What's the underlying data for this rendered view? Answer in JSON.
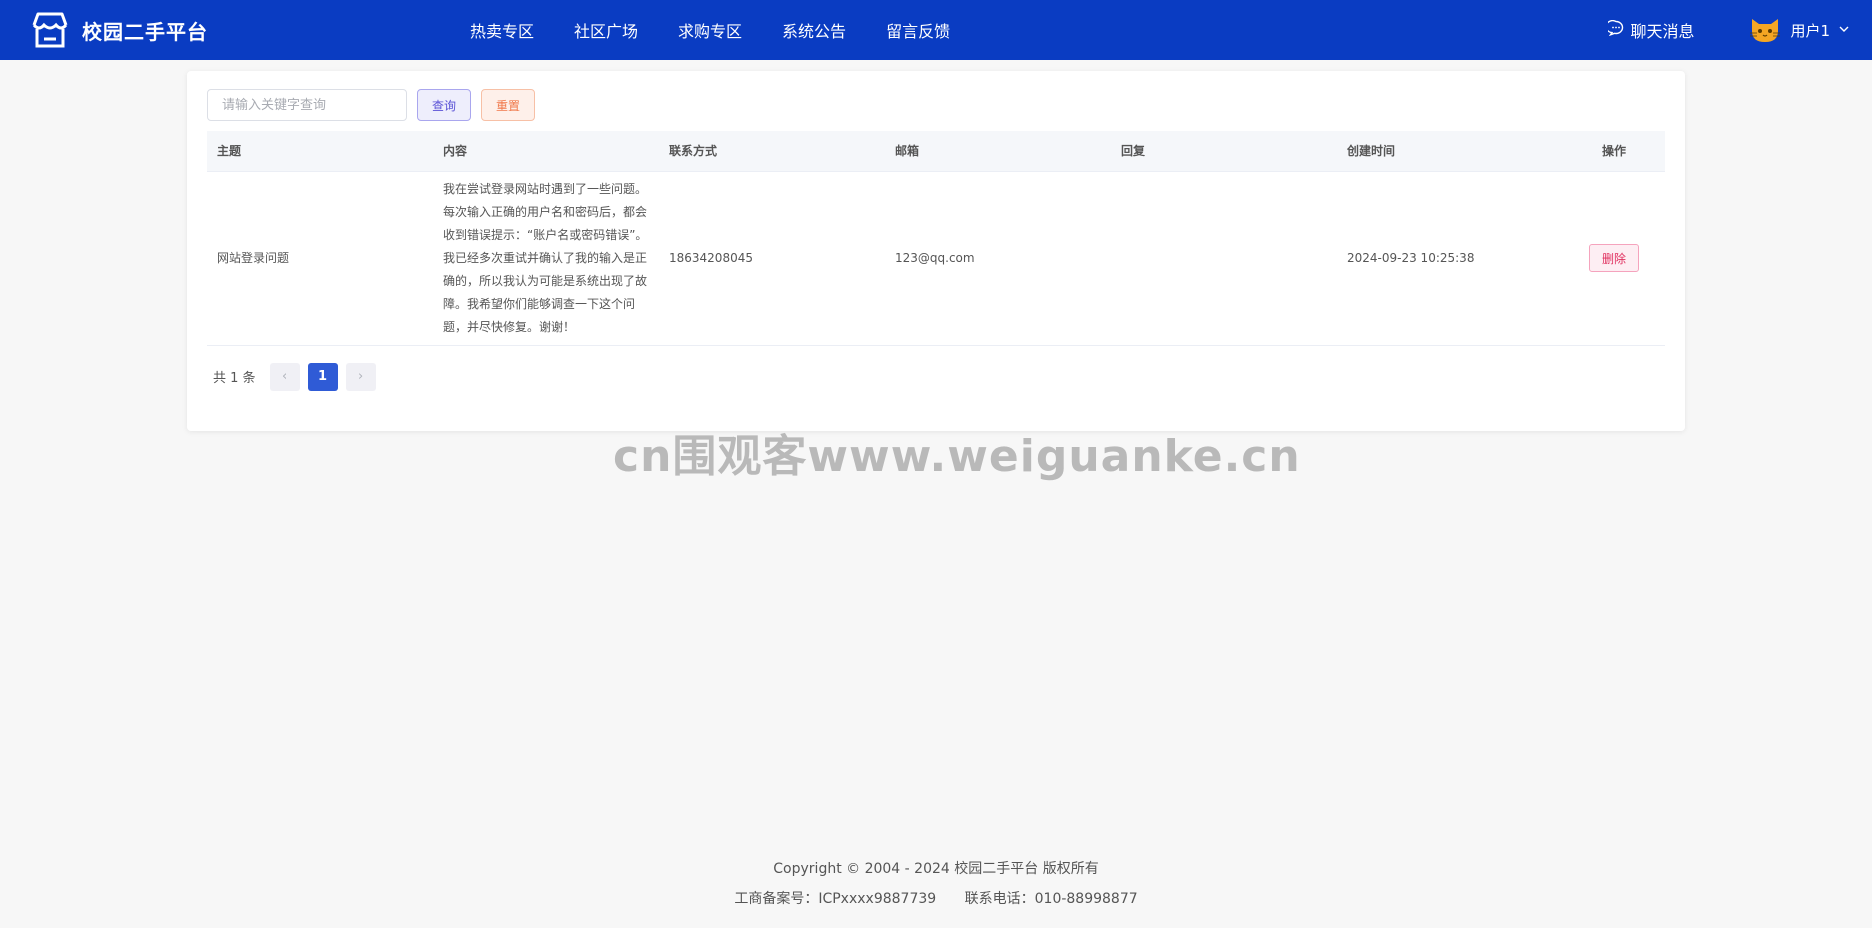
{
  "header": {
    "logo_text": "校园二手平台",
    "nav": [
      "热卖专区",
      "社区广场",
      "求购专区",
      "系统公告",
      "留言反馈"
    ],
    "chat_label": "聊天消息",
    "user_name": "用户1"
  },
  "toolbar": {
    "search_placeholder": "请输入关键字查询",
    "query_label": "查询",
    "reset_label": "重置"
  },
  "table": {
    "columns": [
      "主题",
      "内容",
      "联系方式",
      "邮箱",
      "回复",
      "创建时间",
      "操作"
    ],
    "rows": [
      {
        "subject": "网站登录问题",
        "content": "我在尝试登录网站时遇到了一些问题。每次输入正确的用户名和密码后，都会收到错误提示：“账户名或密码错误”。我已经多次重试并确认了我的输入是正确的，所以我认为可能是系统出现了故障。我希望你们能够调查一下这个问题，并尽快修复。谢谢！",
        "contact": "18634208045",
        "email": "123@qq.com",
        "reply": "",
        "created": "2024-09-23 10:25:38",
        "action": "删除"
      }
    ]
  },
  "pagination": {
    "total": "共 1 条",
    "current": "1",
    "prev": "‹",
    "next": "›"
  },
  "watermark": "cn围观客www.weiguanke.cn",
  "footer": {
    "copyright": "Copyright © 2004 - 2024 校园二手平台 版权所有",
    "icp": "工商备案号：ICPxxxx9887739",
    "phone": "联系电话：010-88998877"
  },
  "colors": {
    "header_bg": "#0a3cc2",
    "page_active": "#2f5bd6",
    "delete": "#e0305f"
  }
}
